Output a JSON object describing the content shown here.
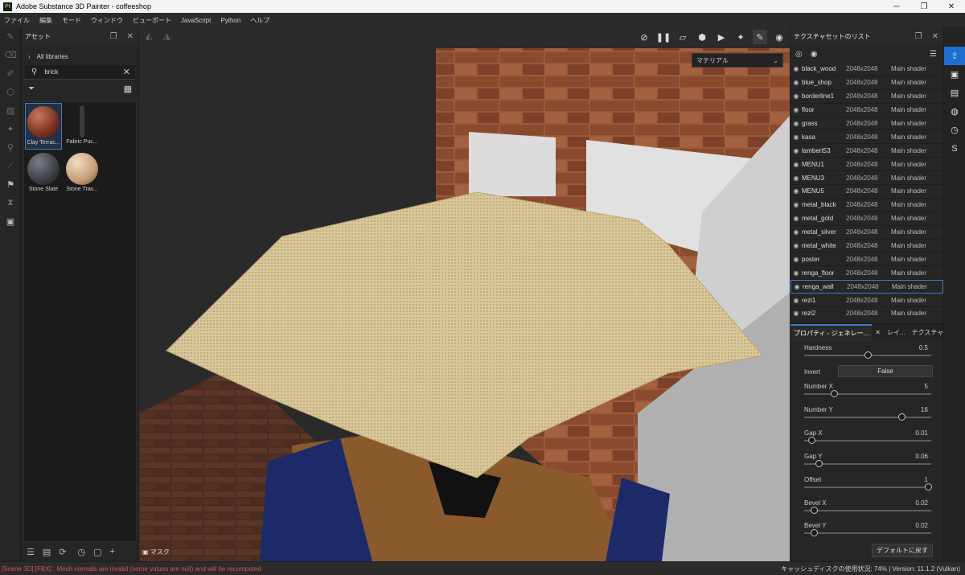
{
  "window": {
    "title": "Adobe Substance 3D Painter - coffeeshop",
    "app_icon": "Pt"
  },
  "menu": [
    "ファイル",
    "編集",
    "モード",
    "ウィンドウ",
    "ビューポート",
    "JavaScript",
    "Python",
    "ヘルプ"
  ],
  "assets": {
    "title": "アセット",
    "breadcrumb": "All libraries",
    "search_value": "brick",
    "items": [
      {
        "label": "Clay Terrac...",
        "color": "#8a3b2a",
        "selected": true
      },
      {
        "label": "Fabric Puc...",
        "color": "#444444",
        "selected": false
      },
      {
        "label": "Stone Slate",
        "color": "#3c3f44",
        "selected": false
      },
      {
        "label": "Stone Trav...",
        "color": "#c8a882",
        "selected": false
      }
    ]
  },
  "viewport": {
    "material_dropdown": "マテリアル",
    "mask_label": "マスク"
  },
  "texture_sets": {
    "title": "テクスチャセットのリスト",
    "rows": [
      {
        "name": "black_wood",
        "size": "2048x2048",
        "shader": "Main shader"
      },
      {
        "name": "blue_shop",
        "size": "2048x2048",
        "shader": "Main shader"
      },
      {
        "name": "borderline1",
        "size": "2048x2048",
        "shader": "Main shader"
      },
      {
        "name": "floor",
        "size": "2048x2048",
        "shader": "Main shader"
      },
      {
        "name": "grass",
        "size": "2048x2048",
        "shader": "Main shader"
      },
      {
        "name": "kasa",
        "size": "2048x2048",
        "shader": "Main shader"
      },
      {
        "name": "lambert53",
        "size": "2048x2048",
        "shader": "Main shader"
      },
      {
        "name": "MENU1",
        "size": "2048x2048",
        "shader": "Main shader"
      },
      {
        "name": "MENU3",
        "size": "2048x2048",
        "shader": "Main shader"
      },
      {
        "name": "MENU5",
        "size": "2048x2048",
        "shader": "Main shader"
      },
      {
        "name": "metal_black",
        "size": "2048x2048",
        "shader": "Main shader"
      },
      {
        "name": "metal_gold",
        "size": "2048x2048",
        "shader": "Main shader"
      },
      {
        "name": "metal_silver",
        "size": "2048x2048",
        "shader": "Main shader"
      },
      {
        "name": "metal_white",
        "size": "2048x2048",
        "shader": "Main shader"
      },
      {
        "name": "poster",
        "size": "2048x2048",
        "shader": "Main shader"
      },
      {
        "name": "renga_floor",
        "size": "2048x2048",
        "shader": "Main shader"
      },
      {
        "name": "renga_wall",
        "size": "2048x2048",
        "shader": "Main shader",
        "selected": true
      },
      {
        "name": "rezi1",
        "size": "2048x2048",
        "shader": "Main shader"
      },
      {
        "name": "rezi2",
        "size": "2048x2048",
        "shader": "Main shader"
      }
    ]
  },
  "tabs": [
    "プロパティ - ジェネレー...",
    "レイ...",
    "テクスチャセットの..."
  ],
  "properties": {
    "hardness": {
      "label": "Hardness",
      "value": "0.5",
      "fraction": 0.5
    },
    "invert": {
      "label": "Invert",
      "value": "False"
    },
    "number_x": {
      "label": "Number X",
      "value": "5",
      "fraction": 0.22
    },
    "number_y": {
      "label": "Number Y",
      "value": "16",
      "fraction": 0.78
    },
    "gap_x": {
      "label": "Gap X",
      "value": "0.01",
      "fraction": 0.03
    },
    "gap_y": {
      "label": "Gap Y",
      "value": "0.06",
      "fraction": 0.09
    },
    "offset": {
      "label": "Offset",
      "value": "1",
      "fraction": 1.0
    },
    "bevel_x": {
      "label": "Bevel X",
      "value": "0.02",
      "fraction": 0.05
    },
    "bevel_y": {
      "label": "Bevel Y",
      "value": "0.02",
      "fraction": 0.05
    },
    "reset_button": "デフォルトに戻す"
  },
  "status": {
    "error": "[Scene 3D] [FBX] : Mesh normals are invalid (some values are null) and will be recomputed",
    "right": "キャッシュディスクの使用状況:   74% | Version: 11.1.2 (Vulkan)"
  },
  "colors": {
    "accent": "#3a80c8",
    "error": "#d9534f",
    "active_tool": "#1e6fd0"
  }
}
